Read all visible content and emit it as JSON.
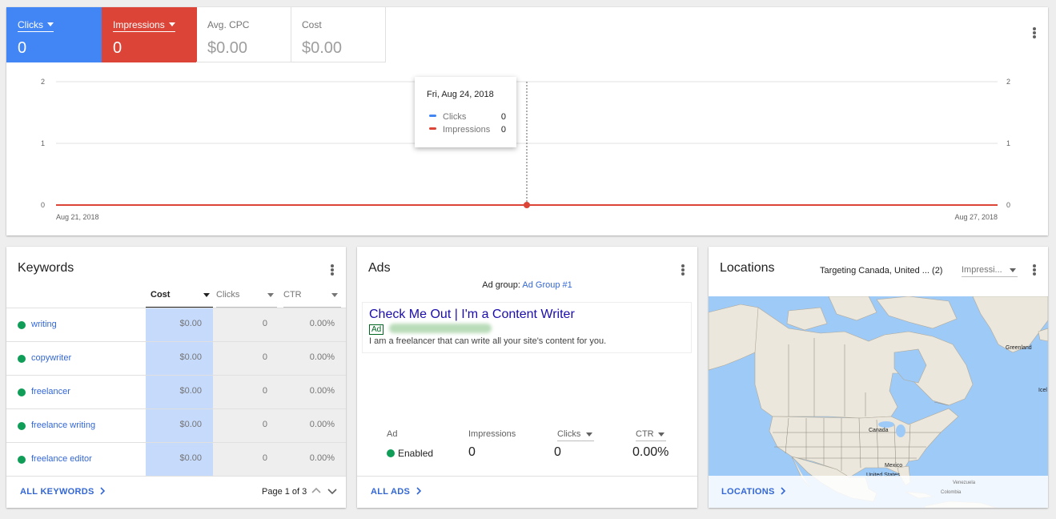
{
  "overview": {
    "metrics": [
      {
        "label": "Clicks",
        "value": "0",
        "color": "#4285f4"
      },
      {
        "label": "Impressions",
        "value": "0",
        "color": "#db4437"
      },
      {
        "label": "Avg. CPC",
        "value": "$0.00"
      },
      {
        "label": "Cost",
        "value": "$0.00"
      }
    ],
    "tooltip": {
      "date": "Fri, Aug 24, 2018",
      "rows": [
        {
          "label": "Clicks",
          "value": "0",
          "color": "#4285f4"
        },
        {
          "label": "Impressions",
          "value": "0",
          "color": "#db4437"
        }
      ]
    }
  },
  "chart_data": {
    "type": "line",
    "x": [
      "Aug 21, 2018",
      "Aug 22, 2018",
      "Aug 23, 2018",
      "Aug 24, 2018",
      "Aug 25, 2018",
      "Aug 26, 2018",
      "Aug 27, 2018"
    ],
    "x_tick_labels": [
      "Aug 21, 2018",
      "Aug 27, 2018"
    ],
    "series": [
      {
        "name": "Clicks",
        "values": [
          0,
          0,
          0,
          0,
          0,
          0,
          0
        ],
        "color": "#4285f4"
      },
      {
        "name": "Impressions",
        "values": [
          0,
          0,
          0,
          0,
          0,
          0,
          0
        ],
        "color": "#db4437"
      }
    ],
    "ylim": [
      0,
      2
    ],
    "y_ticks": [
      "0",
      "1",
      "2"
    ],
    "highlight_index": 3,
    "grid": true
  },
  "keywords": {
    "title": "Keywords",
    "columns": [
      "Cost",
      "Clicks",
      "CTR"
    ],
    "rows": [
      {
        "keyword": "writing",
        "cost": "$0.00",
        "clicks": "0",
        "ctr": "0.00%"
      },
      {
        "keyword": "copywriter",
        "cost": "$0.00",
        "clicks": "0",
        "ctr": "0.00%"
      },
      {
        "keyword": "freelancer",
        "cost": "$0.00",
        "clicks": "0",
        "ctr": "0.00%"
      },
      {
        "keyword": "freelance writing",
        "cost": "$0.00",
        "clicks": "0",
        "ctr": "0.00%"
      },
      {
        "keyword": "freelance editor",
        "cost": "$0.00",
        "clicks": "0",
        "ctr": "0.00%"
      }
    ],
    "footer_link": "ALL KEYWORDS",
    "pagination": "Page 1 of 3"
  },
  "ads": {
    "title": "Ads",
    "ad_group_label": "Ad group:",
    "ad_group_name": "Ad Group #1",
    "headline": "Check Me Out | I'm a Content Writer",
    "ad_tag": "Ad",
    "description": "I am a freelancer that can write all your site's content for you.",
    "stats": {
      "ad_label": "Ad",
      "status": "Enabled",
      "impressions_label": "Impressions",
      "impressions": "0",
      "clicks_label": "Clicks",
      "clicks": "0",
      "ctr_label": "CTR",
      "ctr": "0.00%"
    },
    "footer_link": "ALL ADS"
  },
  "locations": {
    "title": "Locations",
    "targeting": "Targeting Canada, United ... (2)",
    "metric_select": "Impressi...",
    "map_labels": [
      "Greenland",
      "Canada",
      "United States",
      "Mexico",
      "Icel",
      "Venezuela",
      "Colombia"
    ],
    "footer_link": "LOCATIONS"
  }
}
